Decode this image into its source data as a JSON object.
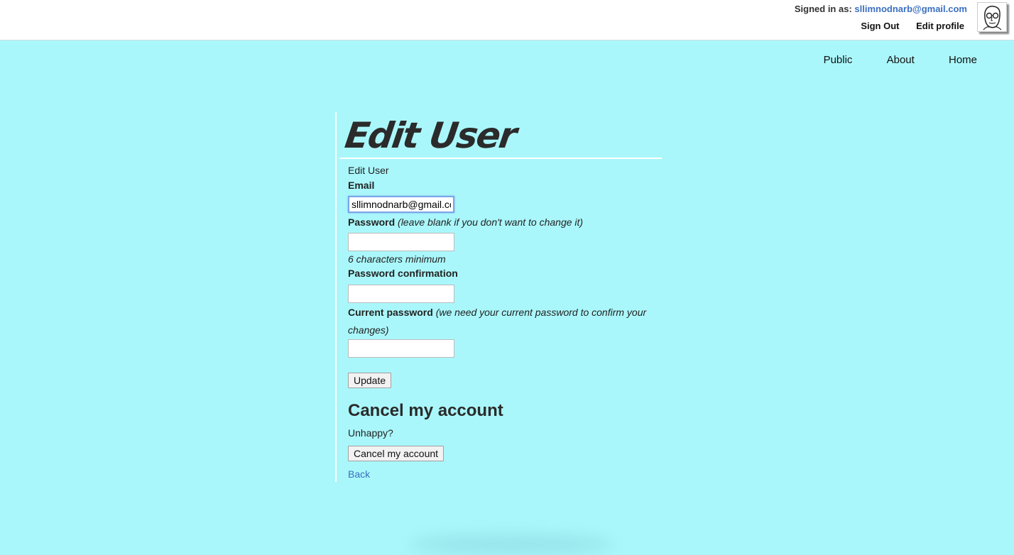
{
  "header": {
    "signed_in_label": "Signed in as:",
    "signed_in_email": "sllimnodnarb@gmail.com",
    "sign_out": "Sign Out",
    "edit_profile": "Edit profile",
    "avatar_icon": "user-avatar-sketch-icon"
  },
  "nav": {
    "items": [
      "Public",
      "About",
      "Home"
    ]
  },
  "page": {
    "title": "Edit User",
    "subtitle": "Edit User"
  },
  "form": {
    "email_label": "Email",
    "email_value": "sllimnodnarb@gmail.com",
    "password_label": "Password",
    "password_hint": "(leave blank if you don't want to change it)",
    "password_min": "6 characters minimum",
    "password_confirmation_label": "Password confirmation",
    "current_password_label": "Current password",
    "current_password_hint": "(we need your current password to confirm your changes)",
    "update_button": "Update"
  },
  "cancel": {
    "heading": "Cancel my account",
    "text": "Unhappy?",
    "button": "Cancel my account"
  },
  "back_link": "Back",
  "colors": {
    "background": "#aaf7fb",
    "link": "#3a6fc1"
  }
}
